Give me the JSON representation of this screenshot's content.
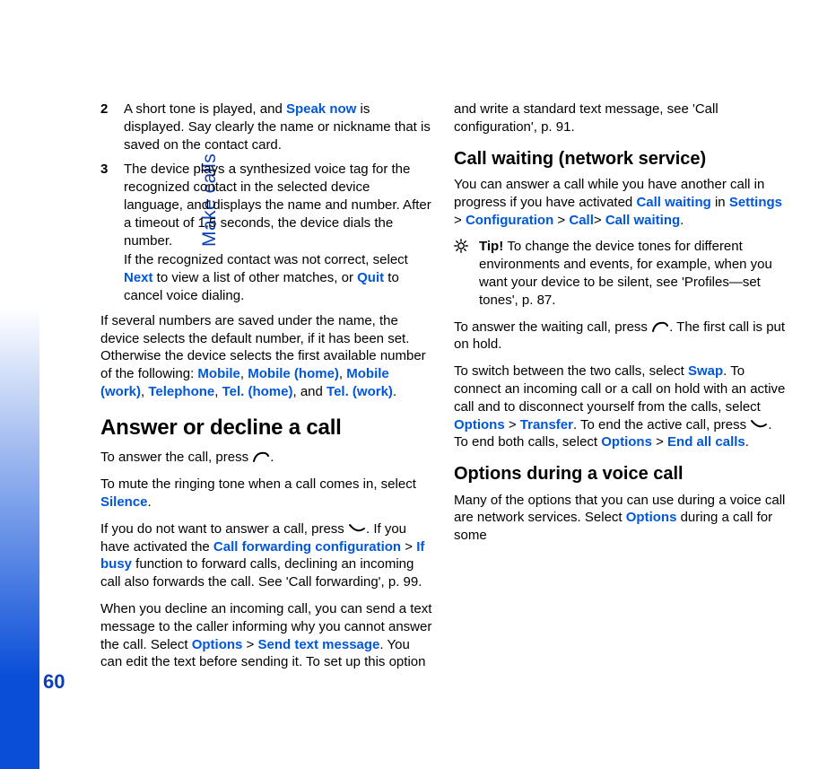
{
  "sidebar": {
    "section_label": "Make calls",
    "page_number": "60"
  },
  "left": {
    "step2": {
      "num": "2",
      "p1a": "A short tone is played, and ",
      "hl1": "Speak now",
      "p1b": " is displayed. Say clearly the name or nickname that is saved on the contact card."
    },
    "step3": {
      "num": "3",
      "p1": "The device plays a synthesized voice tag for the recognized contact in the selected device language, and displays the name and number. After a timeout of 1.5 seconds, the device dials the number.",
      "p2a": "If the recognized contact was not correct, select ",
      "hl_next": "Next",
      "p2b": " to view a list of other matches, or ",
      "hl_quit": "Quit",
      "p2c": " to cancel voice dialing."
    },
    "p_several": {
      "a": "If several numbers are saved under the name, the device selects the default number, if it has been set. Otherwise the device selects the first available number of the following: ",
      "m1": "Mobile",
      "sep1": ", ",
      "m2": "Mobile (home)",
      "sep2": ", ",
      "m3": "Mobile (work)",
      "sep3": ", ",
      "m4": "Telephone",
      "sep4": ", ",
      "m5": "Tel. (home)",
      "sep5": ", and ",
      "m6": "Tel. (work)",
      "tail": "."
    },
    "h2_answer": "Answer or decline a call",
    "p_answer": {
      "a": "To answer the call, press ",
      "b": "."
    },
    "p_mute": {
      "a": "To mute the ringing tone when a call comes in, select ",
      "hl": "Silence",
      "b": "."
    },
    "p_decline": {
      "a": "If you do not want to answer a call, press ",
      "b": ". If you have activated the ",
      "hl1": "Call forwarding configuration",
      "gt1": " > ",
      "hl2": "If busy",
      "c": " function to forward calls, declining an incoming call also forwards the call. See 'Call forwarding', p. 99."
    }
  },
  "right": {
    "p_sendtext": {
      "a": "When you decline an incoming call, you can send a text message to the caller informing why you cannot answer the call. Select ",
      "hl1": "Options",
      "gt1": " > ",
      "hl2": "Send text message",
      "b": ". You can edit the text before sending it. To set up this option and write a standard text message, see 'Call configuration', p. 91."
    },
    "h3_waiting": "Call waiting (network service)",
    "p_cw": {
      "a": "You can answer a call while you have another call in progress if you have activated ",
      "hl1": "Call waiting",
      "in": " in ",
      "hl2": "Settings",
      "gt1": " > ",
      "hl3": "Configuration",
      "gt2": " > ",
      "hl4": "Call",
      "gt3": "> ",
      "hl5": "Call waiting",
      "tail": "."
    },
    "tip": {
      "lead": "Tip! ",
      "body": "To change the device tones for different environments and events, for example, when you want your device to be silent, see 'Profiles—set tones', p. 87."
    },
    "p_answerwait": {
      "a": "To answer the waiting call, press ",
      "b": ". The first call is put on hold."
    },
    "p_switch": {
      "a": "To switch between the two calls, select ",
      "hl_swap": "Swap",
      "b": ". To connect an incoming call or a call on hold with an active call and to disconnect yourself from the calls, select ",
      "hl_opt": "Options",
      "gt1": " > ",
      "hl_trans": "Transfer",
      "c": ". To end the active call, press ",
      "d": ". To end both calls, select ",
      "hl_opt2": "Options",
      "gt2": " > ",
      "hl_endall": "End all calls",
      "tail": "."
    },
    "h3_options": "Options during a voice call",
    "p_opts": {
      "a": "Many of the options that you can use during a voice call are network services. Select ",
      "hl": "Options",
      "b": " during a call for some"
    }
  }
}
